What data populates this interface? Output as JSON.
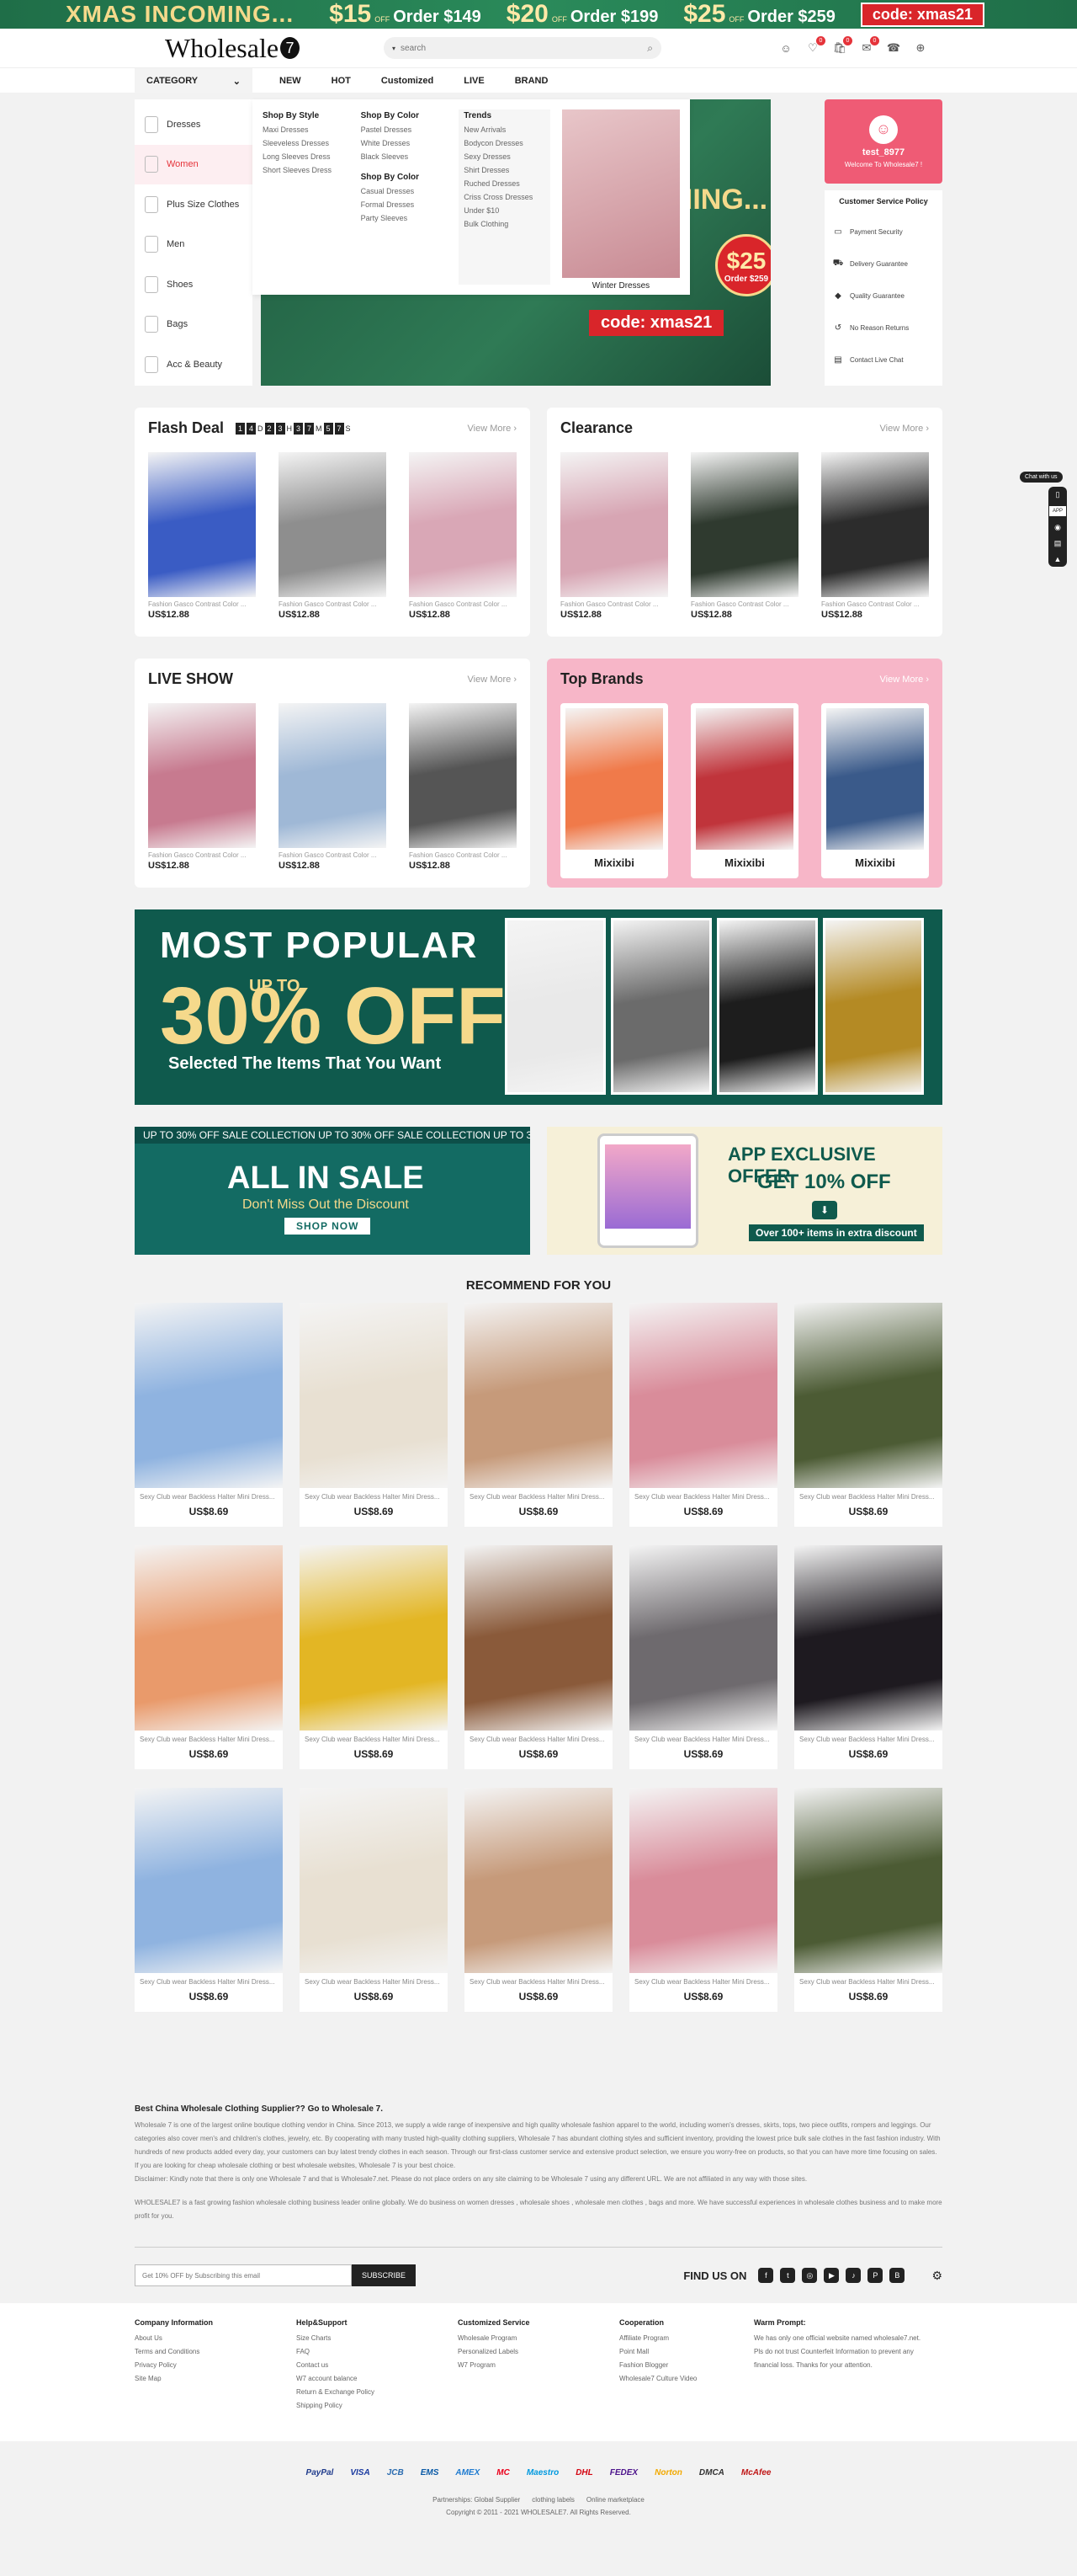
{
  "promo": {
    "title": "XMAS INCOMING...",
    "offers": [
      {
        "amount": "$15",
        "off": "OFF",
        "order": "Order $149"
      },
      {
        "amount": "$20",
        "off": "OFF",
        "order": "Order $199"
      },
      {
        "amount": "$25",
        "off": "OFF",
        "order": "Order $259"
      }
    ],
    "code": "code: xmas21"
  },
  "header": {
    "logo_text": "Wholesale",
    "logo_mark": "7",
    "search_placeholder": "search",
    "badges": {
      "wishlist": "0",
      "cart": "0",
      "messages": "0"
    }
  },
  "nav": {
    "category_label": "CATEGORY",
    "items": [
      "NEW",
      "HOT",
      "Customized",
      "LIVE",
      "BRAND"
    ]
  },
  "category_menu": [
    "Dresses",
    "Women",
    "Plus Size Clothes",
    "Men",
    "Shoes",
    "Bags",
    "Acc & Beauty"
  ],
  "mega_menu": {
    "shop_by_style": {
      "heading": "Shop By Style",
      "links": [
        "Maxi Dresses",
        "Sleeveless Dresses",
        "Long Sleeves Dress",
        "Short Sleeves Dress"
      ]
    },
    "shop_by_color": {
      "heading": "Shop By Color",
      "links": [
        "Pastel Dresses",
        "White Dresses",
        "Black Sleeves"
      ]
    },
    "shop_by_color2": {
      "heading": "Shop By Color",
      "links": [
        "Casual Dresses",
        "Formal Dresses",
        "Party Sleeves"
      ]
    },
    "trends": {
      "heading": "Trends",
      "links": [
        "New Arrivals",
        "Bodycon Dresses",
        "Sexy Dresses",
        "Shirt Dresses",
        "Ruched Dresses",
        "Criss Cross Dresses",
        "Under $10",
        "Bulk Clothing"
      ]
    },
    "feature_caption": "Winter Dresses"
  },
  "hero": {
    "title": "INCOMING...",
    "badge_amount": "$25",
    "badge_order": "Order $259",
    "code": "code: xmas21"
  },
  "user": {
    "name": "test_8977",
    "welcome": "Welcome To Wholesale7 !"
  },
  "customer_service": {
    "title": "Customer Service Policy",
    "items": [
      "Payment Security",
      "Delivery Guarantee",
      "Quality Guarantee",
      "No Reason Returns",
      "Contact Live Chat"
    ]
  },
  "flash_deal": {
    "title": "Flash Deal",
    "timer": {
      "d1": "1",
      "d2": "4",
      "h1": "2",
      "h2": "3",
      "m1": "3",
      "m2": "7",
      "s1": "5",
      "s2": "7",
      "d_label": "D",
      "h_label": "H",
      "m_label": "M",
      "s_label": "S"
    },
    "view_more": "View More",
    "products": [
      {
        "name": "Fashion Gasco Contrast Color ...",
        "price": "US$12.88",
        "color": "#3a5cc4"
      },
      {
        "name": "Fashion Gasco Contrast Color ...",
        "price": "US$12.88",
        "color": "#8e8e8e"
      },
      {
        "name": "Fashion Gasco Contrast Color ...",
        "price": "US$12.88",
        "color": "#d9a7b6"
      }
    ]
  },
  "clearance": {
    "title": "Clearance",
    "view_more": "View More",
    "products": [
      {
        "name": "Fashion Gasco Contrast Color ...",
        "price": "US$12.88",
        "color": "#d7a5b3"
      },
      {
        "name": "Fashion Gasco Contrast Color ...",
        "price": "US$12.88",
        "color": "#2f3a2f"
      },
      {
        "name": "Fashion Gasco Contrast Color ...",
        "price": "US$12.88",
        "color": "#2c2c2c"
      }
    ]
  },
  "live_show": {
    "title": "LIVE SHOW",
    "view_more": "View More",
    "products": [
      {
        "name": "Fashion Gasco Contrast Color ...",
        "price": "US$12.88",
        "color": "#c77a8f"
      },
      {
        "name": "Fashion Gasco Contrast Color ...",
        "price": "US$12.88",
        "color": "#9fb8d6"
      },
      {
        "name": "Fashion Gasco Contrast Color ...",
        "price": "US$12.88",
        "color": "#555555"
      }
    ]
  },
  "top_brands": {
    "title": "Top Brands",
    "view_more": "View More",
    "brands": [
      {
        "name": "Mixixibi",
        "color": "#f07a4a"
      },
      {
        "name": "Mixixibi",
        "color": "#c0343b"
      },
      {
        "name": "Mixixibi",
        "color": "#3a5a8a"
      }
    ]
  },
  "popular_banner": {
    "line1": "MOST POPULAR",
    "upto": "UP TO",
    "line2": "30% OFF",
    "line3": "Selected The Items That You Want",
    "photo_colors": [
      "#e9e9e9",
      "#6b6b6b",
      "#1d1d1d",
      "#b48a24"
    ]
  },
  "sale_banner": {
    "strip": "UP TO 30% OFF   SALE COLLECTION   UP TO 30% OFF   SALE COLLECTION   UP TO 30% OFF   SALE COLLECTION",
    "title": "ALL IN SALE",
    "subtitle": "Don't Miss Out the Discount",
    "button": "SHOP NOW"
  },
  "app_banner": {
    "title": "APP EXCLUSIVE OFFER",
    "subtitle": "GET 10% OFF",
    "note": "Over 100+ items in extra discount"
  },
  "recommend": {
    "title": "RECOMMEND FOR YOU",
    "items": [
      {
        "name": "Sexy Club wear Backless Halter Mini Dress...",
        "price": "US$8.69",
        "color": "#8fb3e0"
      },
      {
        "name": "Sexy Club wear Backless Halter Mini Dress...",
        "price": "US$8.69",
        "color": "#e8e0d2"
      },
      {
        "name": "Sexy Club wear Backless Halter Mini Dress...",
        "price": "US$8.69",
        "color": "#c69a7a"
      },
      {
        "name": "Sexy Club wear Backless Halter Mini Dress...",
        "price": "US$8.69",
        "color": "#d98c9a"
      },
      {
        "name": "Sexy Club wear Backless Halter Mini Dress...",
        "price": "US$8.69",
        "color": "#4c5b34"
      },
      {
        "name": "Sexy Club wear Backless Halter Mini Dress...",
        "price": "US$8.69",
        "color": "#e99a6b"
      },
      {
        "name": "Sexy Club wear Backless Halter Mini Dress...",
        "price": "US$8.69",
        "color": "#e3b624"
      },
      {
        "name": "Sexy Club wear Backless Halter Mini Dress...",
        "price": "US$8.69",
        "color": "#8a5a3a"
      },
      {
        "name": "Sexy Club wear Backless Halter Mini Dress...",
        "price": "US$8.69",
        "color": "#6e6a6e"
      },
      {
        "name": "Sexy Club wear Backless Halter Mini Dress...",
        "price": "US$8.69",
        "color": "#1e1a20"
      },
      {
        "name": "Sexy Club wear Backless Halter Mini Dress...",
        "price": "US$8.69",
        "color": "#8fb3e0"
      },
      {
        "name": "Sexy Club wear Backless Halter Mini Dress...",
        "price": "US$8.69",
        "color": "#e8e0d2"
      },
      {
        "name": "Sexy Club wear Backless Halter Mini Dress...",
        "price": "US$8.69",
        "color": "#c69a7a"
      },
      {
        "name": "Sexy Club wear Backless Halter Mini Dress...",
        "price": "US$8.69",
        "color": "#d98c9a"
      },
      {
        "name": "Sexy Club wear Backless Halter Mini Dress...",
        "price": "US$8.69",
        "color": "#4c5b34"
      }
    ]
  },
  "about": {
    "heading": "Best China Wholesale Clothing Supplier?? Go to Wholesale 7.",
    "p1": "Wholesale 7 is one of the largest online boutique clothing vendor in China. Since 2013, we supply a wide range of inexpensive and high quality wholesale fashion apparel to the world, including women's dresses, skirts, tops, two piece outfits, rompers and leggings. Our categories also cover men's and children's clothes, jewelry, etc. By cooperating with many trusted high-quality clothing suppliers, Wholesale 7 has abundant clothing styles and sufficient inventory, providing the lowest price bulk sale clothes in the fast fashion industry. With hundreds of new products added every day, your customers can buy latest trendy clothes in each season. Through our first-class customer service and extensive product selection, we ensure you worry-free on products, so that you can have more time focusing on sales. If you are looking for cheap wholesale clothing or best wholesale websites, Wholesale 7 is your best choice.",
    "p2": "Disclaimer: Kindly note that there is only one Wholesale 7 and that is Wholesale7.net. Please do not place orders on any site claiming to be Wholesale 7 using any different URL. We are not affiliated in any way with those sites.",
    "p3": "WHOLESALE7 is a fast growing fashion wholesale clothing business leader online globally. We do business on women dresses , wholesale shoes , wholesale men clothes , bags and more. We have successful experiences in wholesale clothes business and to make more profit for you."
  },
  "subscribe": {
    "placeholder": "Get 10% OFF by Subscribing this email",
    "button": "SUBSCRIBE"
  },
  "find_us": {
    "label": "FIND US ON",
    "icons": [
      "f",
      "t",
      "◎",
      "▶",
      "♪",
      "P",
      "B"
    ]
  },
  "footer": {
    "company": {
      "heading": "Company Information",
      "links": [
        "About Us",
        "Terms and Conditions",
        "Privacy Policy",
        "Site Map"
      ]
    },
    "help": {
      "heading": "Help&Support",
      "links": [
        "Size Charts",
        "FAQ",
        "Contact us",
        "W7 account balance",
        "Return & Exchange Policy",
        "Shipping Policy"
      ]
    },
    "custom": {
      "heading": "Customized Service",
      "links": [
        "Wholesale Program",
        "Personalized Labels",
        "W7 Program"
      ]
    },
    "coop": {
      "heading": "Cooperation",
      "links": [
        "Affiliate Program",
        "Point Mall",
        "Fashion Blogger",
        "Wholesale7 Culture Video"
      ]
    },
    "warn": {
      "heading": "Warm Prompt:",
      "text": "We has only one official website named wholesale7.net. Pls do not trust Counterfeit Information to prevent any financial loss. Thanks for your attention."
    }
  },
  "payments": [
    "PayPal",
    "VISA",
    "JCB",
    "EMS",
    "AMEX",
    "MC",
    "Maestro",
    "DHL",
    "FEDEX",
    "Norton",
    "DMCA",
    "McAfee"
  ],
  "copyright": {
    "links": [
      "Partnerships: Global Supplier",
      "clothing labels",
      "Online marketplace"
    ],
    "text": "Copyright © 2011 - 2021 WHOLESALE7. All Rights Reserved."
  },
  "floating": {
    "chat_tip": "Chat with us",
    "app_label": "APP"
  }
}
